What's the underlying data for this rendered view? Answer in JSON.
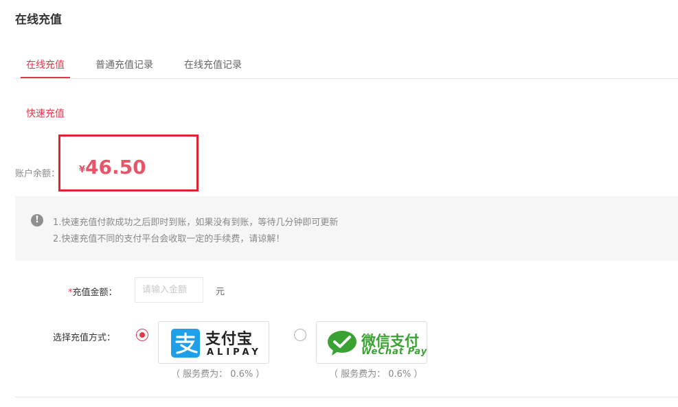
{
  "page": {
    "title": "在线充值"
  },
  "tabs": [
    {
      "label": "在线充值",
      "active": true
    },
    {
      "label": "普通充值记录",
      "active": false
    },
    {
      "label": "在线充值记录",
      "active": false
    }
  ],
  "section": {
    "label": "快速充值"
  },
  "balance": {
    "label": "账户余额：",
    "currency": "¥",
    "amount": "46.50"
  },
  "notice": {
    "icon": "exclamation-icon",
    "line1": "1.快速充值付款成功之后即时到账，如果没有到账，等待几分钟即可更新",
    "line2": "2.快速充值不同的支付平台会收取一定的手续费，请谅解！"
  },
  "form": {
    "amount_required_mark": "*",
    "amount_label": "充值金额：",
    "amount_placeholder": "请输入金额",
    "amount_value": "",
    "unit": "元",
    "method_label": "选择充值方式："
  },
  "payment_methods": [
    {
      "id": "alipay",
      "selected": true,
      "logo_cn": "支付宝",
      "logo_en": "ALIPAY",
      "fee": "（ 服务费为： 0.6% ）"
    },
    {
      "id": "wechat",
      "selected": false,
      "logo_cn": "微信支付",
      "logo_en": "WeChat Pay",
      "fee": "（ 服务费为： 0.6% ）"
    }
  ],
  "colors": {
    "accent": "#e0374b",
    "balance": "#e85568",
    "highlight_box": "#e0232f",
    "alipay": "#1e9fe8",
    "wechat": "#3aa233"
  }
}
